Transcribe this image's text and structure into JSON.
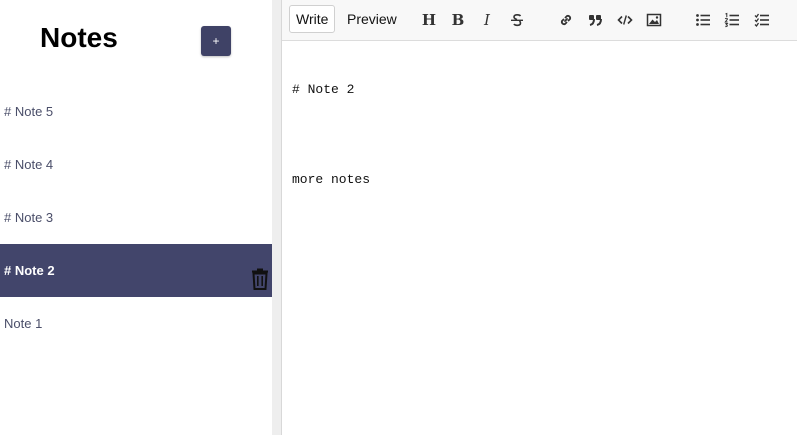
{
  "sidebar": {
    "title": "Notes",
    "new_button_label": "+",
    "notes": [
      {
        "label": "# Note 5",
        "selected": false
      },
      {
        "label": "# Note 4",
        "selected": false
      },
      {
        "label": "# Note 3",
        "selected": false
      },
      {
        "label": "# Note 2",
        "selected": true
      },
      {
        "label": "Note 1",
        "selected": false
      }
    ],
    "delete_icon": "trash-icon"
  },
  "editor": {
    "tabs": [
      {
        "label": "Write",
        "active": true
      },
      {
        "label": "Preview",
        "active": false
      }
    ],
    "toolbar_icons": [
      "heading-icon",
      "bold-icon",
      "italic-icon",
      "strikethrough-icon",
      "link-icon",
      "quote-icon",
      "code-icon",
      "image-icon",
      "unordered-list-icon",
      "ordered-list-icon",
      "checklist-icon"
    ],
    "content_lines": [
      "# Note 2",
      "",
      "more notes"
    ]
  },
  "colors": {
    "accent": "#42456b",
    "text": "#4a4e69"
  }
}
